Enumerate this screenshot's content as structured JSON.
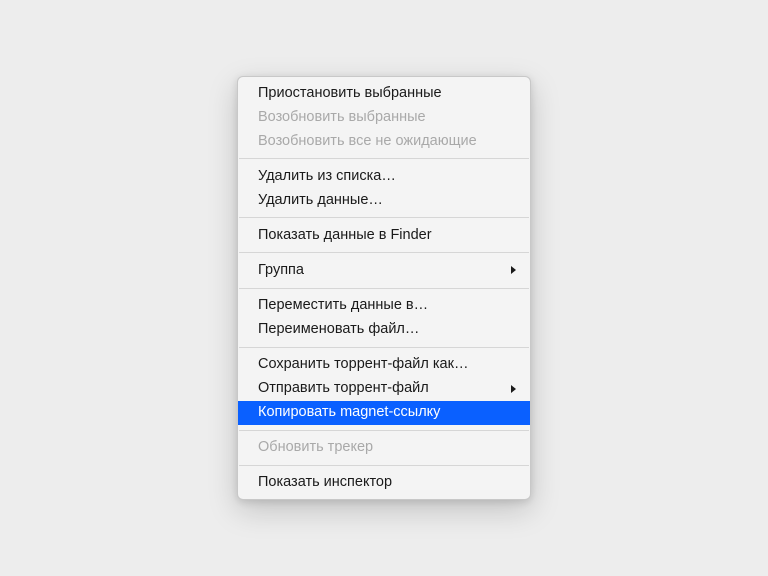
{
  "menu": {
    "items": [
      {
        "label": "Приостановить выбранные",
        "disabled": false,
        "hasSubmenu": false,
        "highlighted": false
      },
      {
        "label": "Возобновить выбранные",
        "disabled": true,
        "hasSubmenu": false,
        "highlighted": false
      },
      {
        "label": "Возобновить все не ожидающие",
        "disabled": true,
        "hasSubmenu": false,
        "highlighted": false
      },
      {
        "separator": true
      },
      {
        "label": "Удалить из списка…",
        "disabled": false,
        "hasSubmenu": false,
        "highlighted": false
      },
      {
        "label": "Удалить данные…",
        "disabled": false,
        "hasSubmenu": false,
        "highlighted": false
      },
      {
        "separator": true
      },
      {
        "label": "Показать данные в Finder",
        "disabled": false,
        "hasSubmenu": false,
        "highlighted": false
      },
      {
        "separator": true
      },
      {
        "label": "Группа",
        "disabled": false,
        "hasSubmenu": true,
        "highlighted": false
      },
      {
        "separator": true
      },
      {
        "label": "Переместить данные в…",
        "disabled": false,
        "hasSubmenu": false,
        "highlighted": false
      },
      {
        "label": "Переименовать файл…",
        "disabled": false,
        "hasSubmenu": false,
        "highlighted": false
      },
      {
        "separator": true
      },
      {
        "label": "Сохранить торрент-файл как…",
        "disabled": false,
        "hasSubmenu": false,
        "highlighted": false
      },
      {
        "label": "Отправить торрент-файл",
        "disabled": false,
        "hasSubmenu": true,
        "highlighted": false
      },
      {
        "label": "Копировать magnet-ссылку",
        "disabled": false,
        "hasSubmenu": false,
        "highlighted": true
      },
      {
        "separator": true
      },
      {
        "label": "Обновить трекер",
        "disabled": true,
        "hasSubmenu": false,
        "highlighted": false
      },
      {
        "separator": true
      },
      {
        "label": "Показать инспектор",
        "disabled": false,
        "hasSubmenu": false,
        "highlighted": false
      }
    ]
  },
  "colors": {
    "highlight": "#0a60ff",
    "background": "#ededed",
    "menuBackground": "#f4f4f4",
    "separator": "#d6d6d6",
    "disabledText": "#a9a9a9",
    "text": "#1a1a1a"
  }
}
